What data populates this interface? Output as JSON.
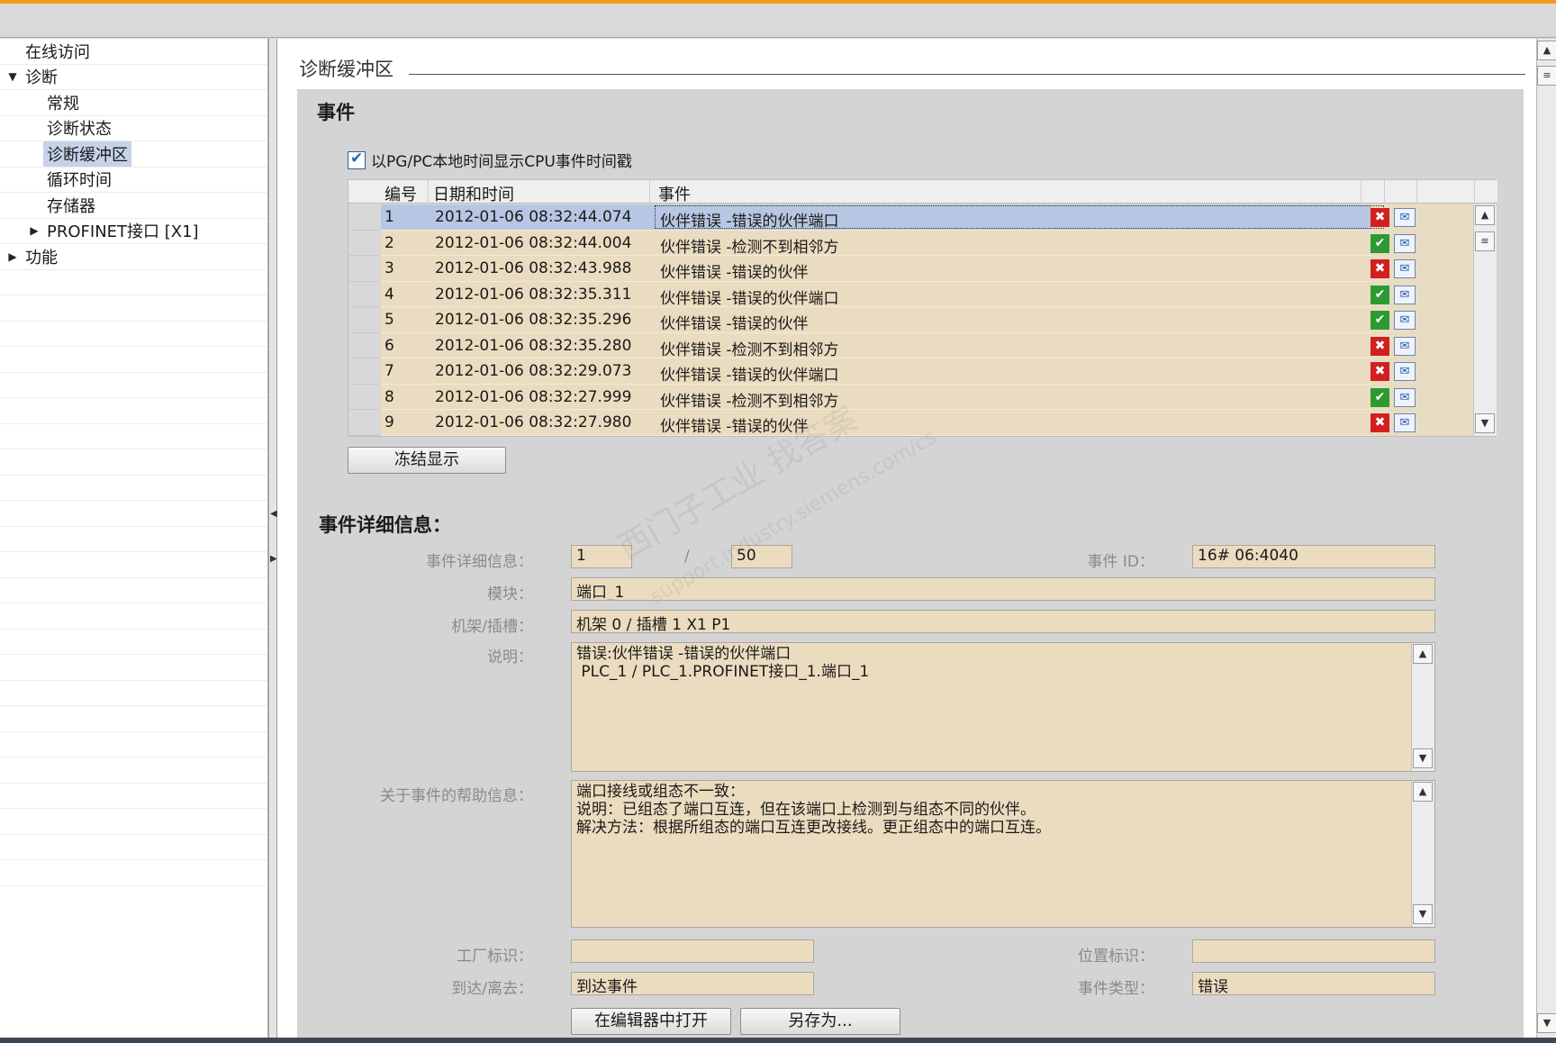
{
  "nav": {
    "items": [
      {
        "label": "在线访问",
        "expander": "",
        "selected": false
      },
      {
        "label": "诊断",
        "expander": "▼",
        "selected": false
      },
      {
        "label": "常规",
        "expander": "",
        "selected": false
      },
      {
        "label": "诊断状态",
        "expander": "",
        "selected": false
      },
      {
        "label": "诊断缓冲区",
        "expander": "",
        "selected": true
      },
      {
        "label": "循环时间",
        "expander": "",
        "selected": false
      },
      {
        "label": "存储器",
        "expander": "",
        "selected": false
      },
      {
        "label": "PROFINET接口 [X1]",
        "expander": "▶",
        "selected": false
      },
      {
        "label": "功能",
        "expander": "▶",
        "selected": false
      }
    ]
  },
  "section": {
    "title": "诊断缓冲区",
    "events_heading": "事件",
    "local_time_checkbox": {
      "label": "以PG/PC本地时间显示CPU事件时间戳",
      "checked": true
    }
  },
  "table": {
    "headers": {
      "no": "编号",
      "datetime": "日期和时间",
      "event": "事件"
    },
    "rows": [
      {
        "no": "1",
        "datetime": "2012-01-06 08:32:44.074",
        "event": "伙伴错误 -错误的伙伴端口",
        "status": "error"
      },
      {
        "no": "2",
        "datetime": "2012-01-06 08:32:44.004",
        "event": "伙伴错误 -检测不到相邻方",
        "status": "ok"
      },
      {
        "no": "3",
        "datetime": "2012-01-06 08:32:43.988",
        "event": "伙伴错误 -错误的伙伴",
        "status": "error"
      },
      {
        "no": "4",
        "datetime": "2012-01-06 08:32:35.311",
        "event": "伙伴错误 -错误的伙伴端口",
        "status": "ok"
      },
      {
        "no": "5",
        "datetime": "2012-01-06 08:32:35.296",
        "event": "伙伴错误 -错误的伙伴",
        "status": "ok"
      },
      {
        "no": "6",
        "datetime": "2012-01-06 08:32:35.280",
        "event": "伙伴错误 -检测不到相邻方",
        "status": "error"
      },
      {
        "no": "7",
        "datetime": "2012-01-06 08:32:29.073",
        "event": "伙伴错误 -错误的伙伴端口",
        "status": "error"
      },
      {
        "no": "8",
        "datetime": "2012-01-06 08:32:27.999",
        "event": "伙伴错误 -检测不到相邻方",
        "status": "ok"
      },
      {
        "no": "9",
        "datetime": "2012-01-06 08:32:27.980",
        "event": "伙伴错误 -错误的伙伴",
        "status": "error"
      }
    ],
    "selected_row": 1,
    "freeze_button": "冻结显示"
  },
  "detail": {
    "heading": "事件详细信息：",
    "labels": {
      "detail_info": "事件详细信息：",
      "event_id": "事件 ID：",
      "module": "模块：",
      "rack_slot": "机架/插槽：",
      "description": "说明：",
      "help": "关于事件的帮助信息：",
      "plant_id": "工厂标识：",
      "location_id": "位置标识：",
      "arrive_leave": "到达/离去：",
      "event_type": "事件类型："
    },
    "values": {
      "detail_index": "1",
      "separator": "/",
      "detail_total": "50",
      "event_id": "16# 06:4040",
      "module": "端口_1",
      "rack_slot": "机架 0 / 插槽 1 X1 P1",
      "description_lines": [
        "错误:伙伴错误 -错误的伙伴端口",
        " PLC_1 / PLC_1.PROFINET接口_1.端口_1"
      ],
      "help_lines": [
        "端口接线或组态不一致：",
        "说明：已组态了端口互连，但在该端口上检测到与组态不同的伙伴。",
        "解决方法：根据所组态的端口互连更改接线。更正组态中的端口互连。"
      ],
      "plant_id": "",
      "location_id": "",
      "arrive_leave": "到达事件",
      "event_type": "错误"
    },
    "buttons": {
      "open_in_editor": "在编辑器中打开",
      "save_as": "另存为..."
    }
  },
  "watermark": {
    "line1": "西门子工业 找答案",
    "line2": "support.industry.siemens.com/cs"
  },
  "colors": {
    "accent": "#f39a1e",
    "field_bg": "#ecdcbf",
    "row_selected": "#b7c6e2",
    "error": "#d21f1f",
    "ok": "#2d9a32"
  }
}
